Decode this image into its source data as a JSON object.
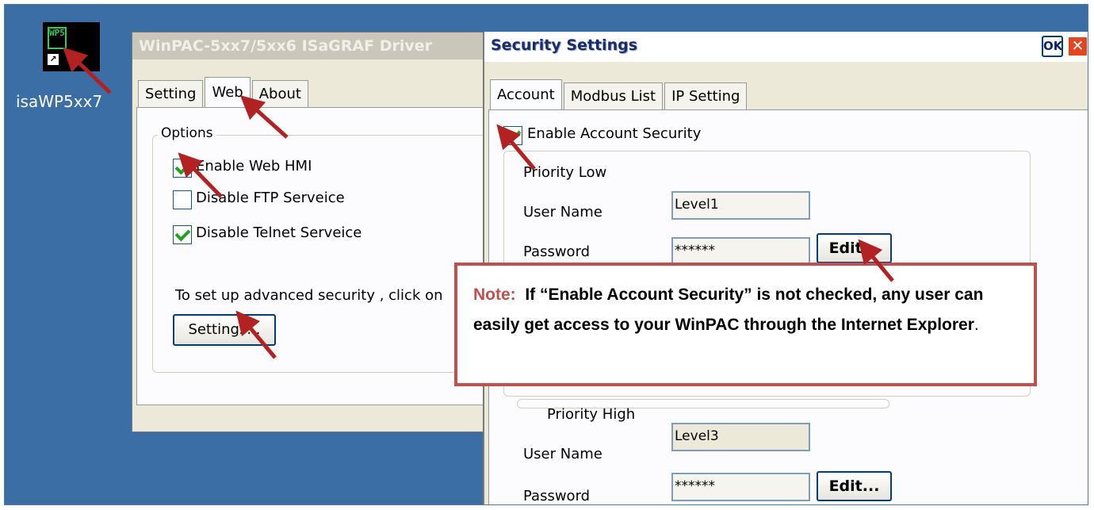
{
  "desktop": {
    "icon_label": "isaWP5xx7",
    "icon_logo_text": "WP5"
  },
  "driver_window": {
    "title": "WinPAC-5xx7/5xx6 ISaGRAF Driver",
    "tabs": [
      {
        "label": "Setting",
        "active": false
      },
      {
        "label": "Web",
        "active": true
      },
      {
        "label": "About",
        "active": false
      }
    ],
    "options_legend": "Options",
    "options": [
      {
        "label": "Enable Web HMI",
        "checked": true
      },
      {
        "label": "Disable FTP Serveice",
        "checked": false
      },
      {
        "label": "Disable Telnet Serveice",
        "checked": true
      }
    ],
    "advanced_text": "To set up advanced security , click on",
    "settings_button": "Settings..."
  },
  "security_window": {
    "title": "Security Settings",
    "ok_label": "OK",
    "close_label": "✕",
    "tabs": [
      {
        "label": "Account",
        "active": true
      },
      {
        "label": "Modbus List",
        "active": false
      },
      {
        "label": "IP Setting",
        "active": false
      }
    ],
    "enable_account_security": {
      "label": "Enable Account Security",
      "checked": true
    },
    "priority_low": {
      "title": "Priority Low",
      "user_name_label": "User Name",
      "user_name_value": "Level1",
      "password_label": "Password",
      "password_value": "******",
      "edit_button": "Edit..."
    },
    "priority_high": {
      "title": "Priority High",
      "user_name_label": "User Name",
      "user_name_value": "Level3",
      "password_label": "Password",
      "password_value": "******",
      "edit_button": "Edit..."
    }
  },
  "note": {
    "label": "Note:",
    "text_part1": "If “Enable Account Security” is not checked, any user can easily get access to your WinPAC through the Internet Explorer",
    "text_part2": "."
  },
  "colors": {
    "desktop": "#3a6ea5",
    "window_bg": "#ece9d8",
    "note_border": "#c0504d",
    "arrow": "#b22222",
    "check": "#21a121"
  }
}
